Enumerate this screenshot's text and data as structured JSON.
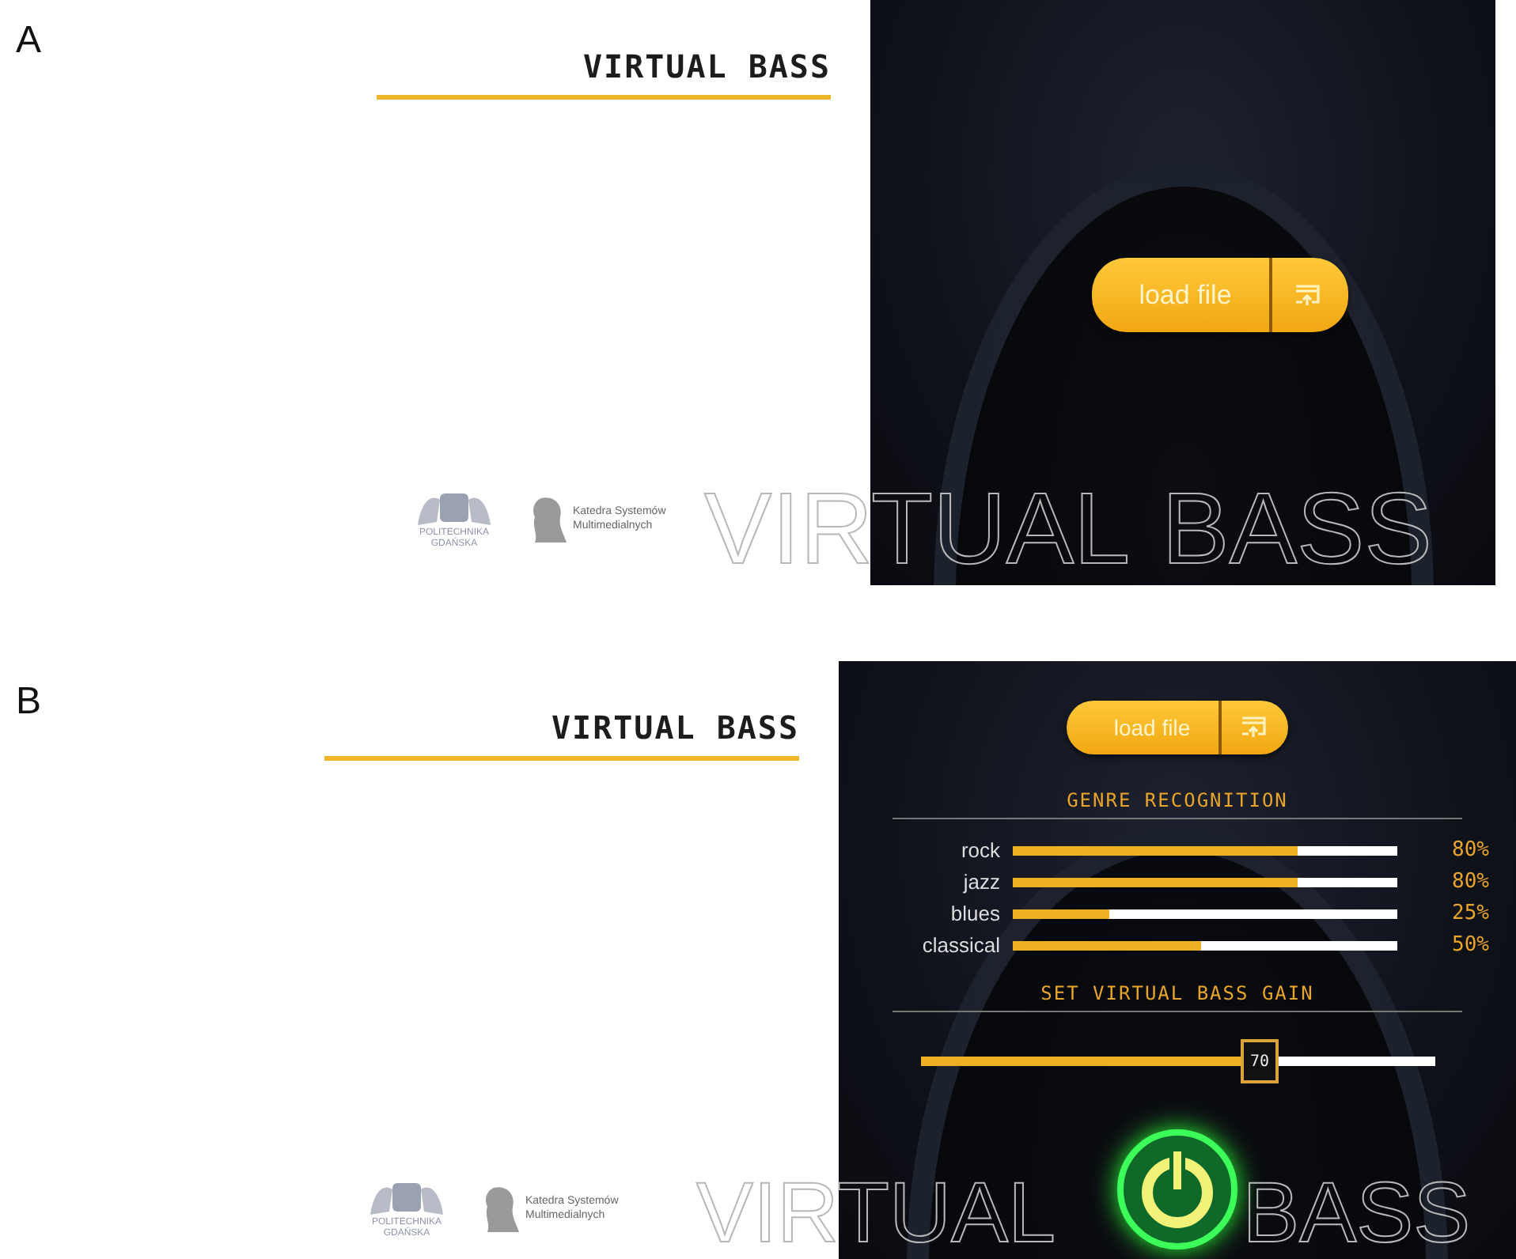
{
  "panels": [
    {
      "label": "A",
      "title": "VIRTUAL BASS",
      "background_text": [
        "VIRTUAL",
        "BASS"
      ],
      "university": [
        "POLITECHNIKA",
        "GDAŃSKA"
      ],
      "department": [
        "Katedra Systemów",
        "Multimedialnych"
      ],
      "load_button": "load file"
    },
    {
      "label": "B",
      "title": "VIRTUAL BASS",
      "background_text": [
        "VIRTUAL",
        "BASS"
      ],
      "university": [
        "POLITECHNIKA",
        "GDAŃSKA"
      ],
      "department": [
        "Katedra Systemów",
        "Multimedialnych"
      ],
      "load_button": "load file",
      "genre": {
        "title": "GENRE RECOGNITION",
        "rows": [
          {
            "name": "rock",
            "level": 0.74,
            "reading": "80%"
          },
          {
            "name": "jazz",
            "level": 0.74,
            "reading": "80%"
          },
          {
            "name": "blues",
            "level": 0.25,
            "reading": "25%"
          },
          {
            "name": "classical",
            "level": 0.49,
            "reading": "50%"
          }
        ]
      },
      "gain": {
        "title": "SET VIRTUAL BASS GAIN",
        "level": 0.66,
        "value": "70"
      },
      "power": {
        "on": true
      }
    }
  ]
}
